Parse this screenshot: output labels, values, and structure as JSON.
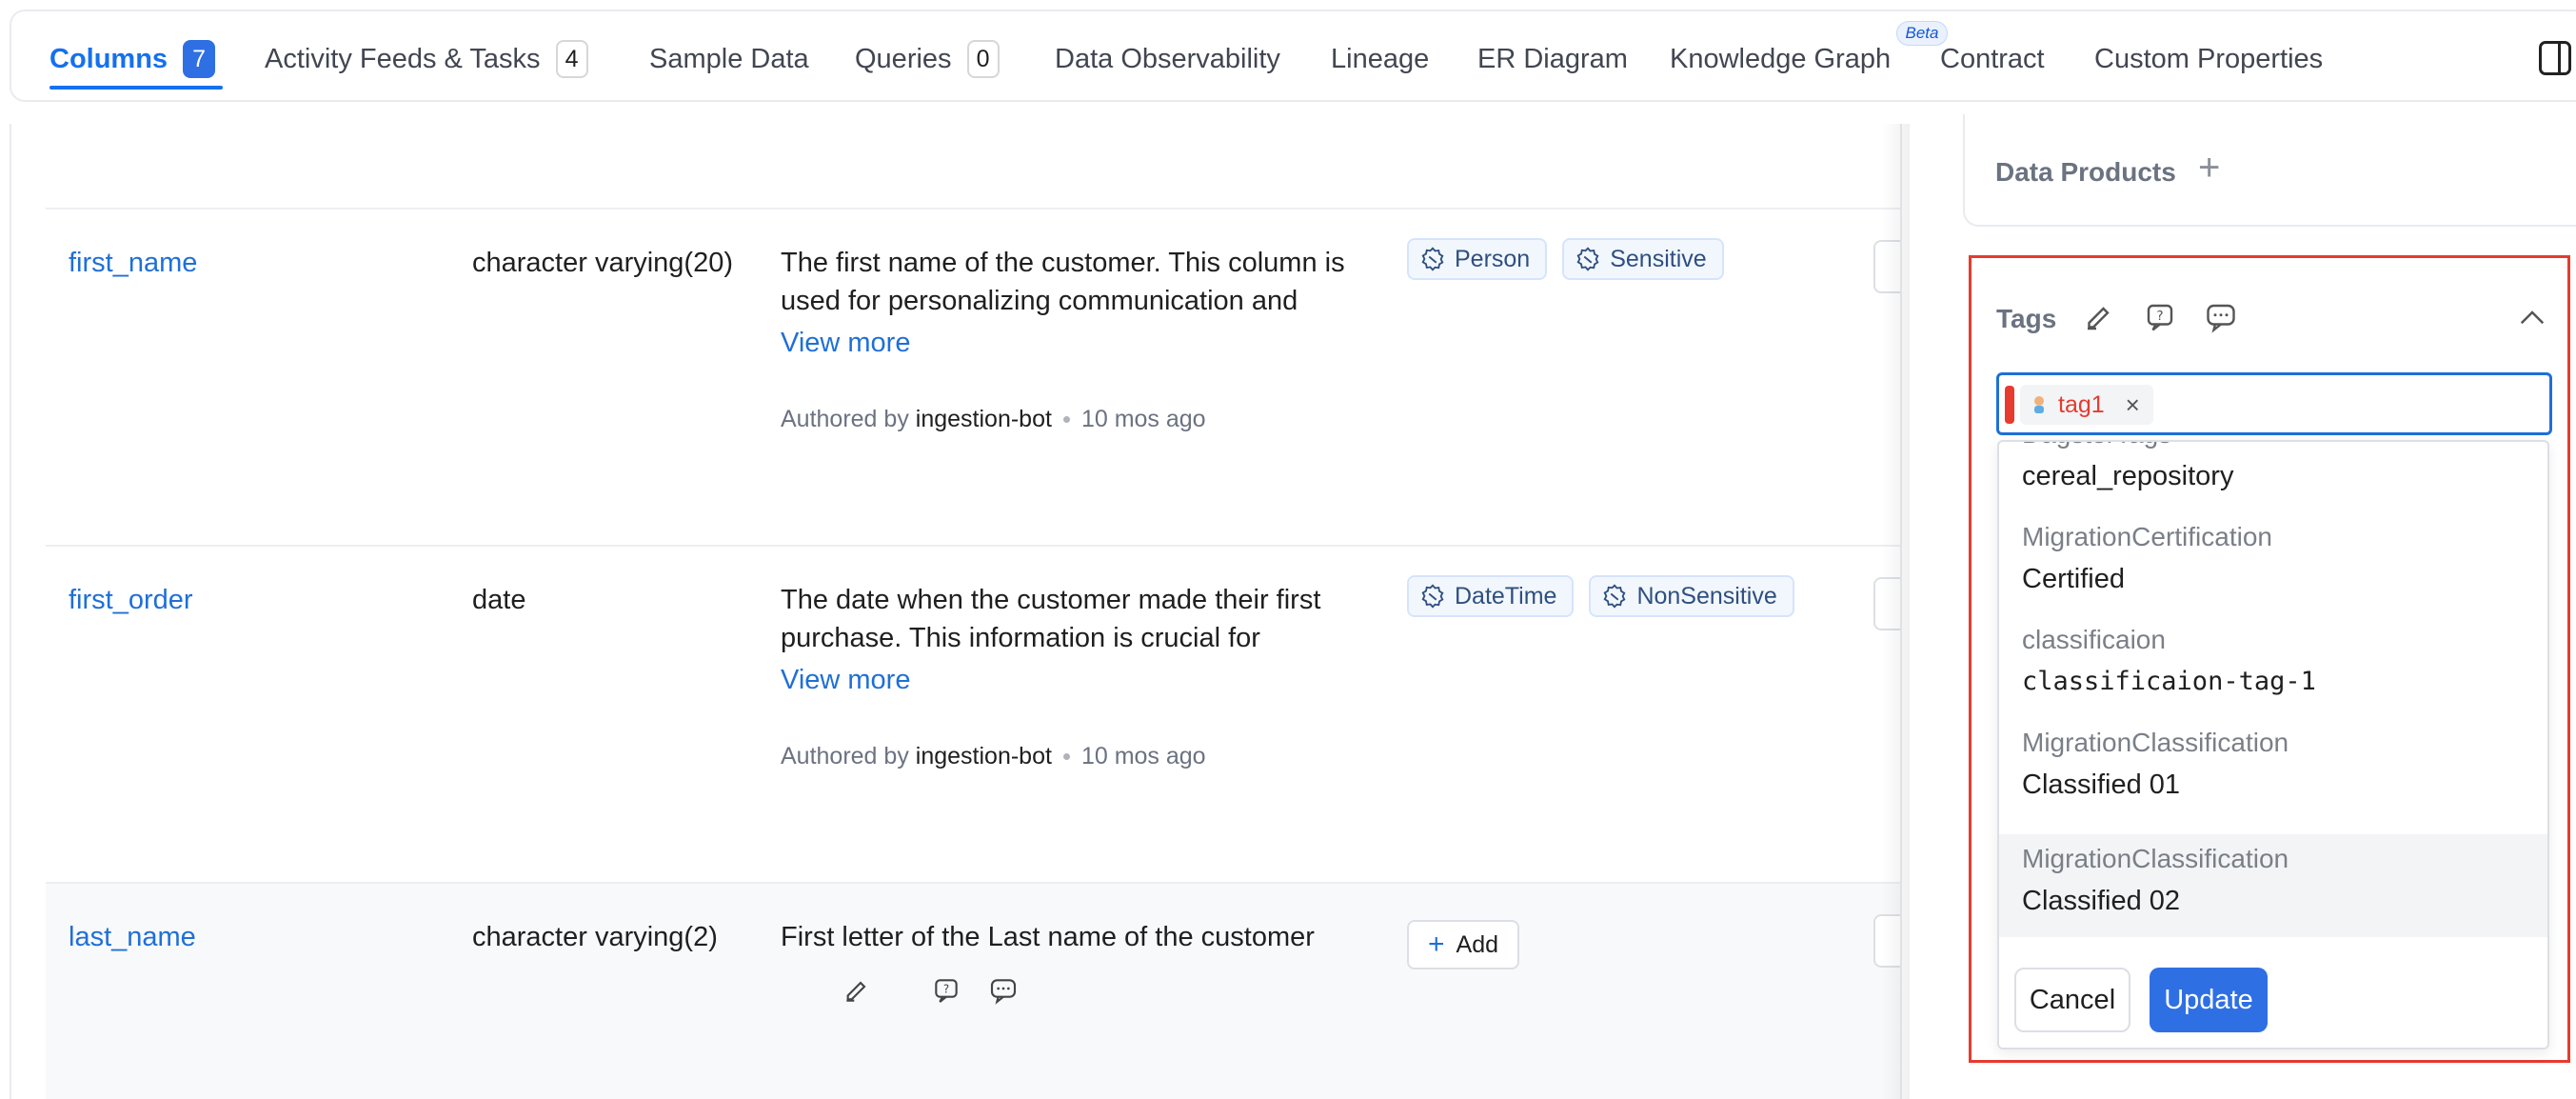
{
  "tabs": [
    {
      "label": "Columns",
      "count": "7"
    },
    {
      "label": "Activity Feeds & Tasks",
      "count": "4"
    },
    {
      "label": "Sample Data"
    },
    {
      "label": "Queries",
      "count": "0"
    },
    {
      "label": "Data Observability"
    },
    {
      "label": "Lineage"
    },
    {
      "label": "ER Diagram"
    },
    {
      "label": "Knowledge Graph",
      "badge": "Beta"
    },
    {
      "label": "Contract"
    },
    {
      "label": "Custom Properties"
    }
  ],
  "rows": [
    {
      "name": "first_name",
      "type": "character varying(20)",
      "description": "The first name of the customer. This column is used for personalizing communication and identifying customers.",
      "view_more": "View more",
      "authored_prefix": "Authored by",
      "author": "ingestion-bot",
      "time": "10 mos ago",
      "tags": [
        "Person",
        "Sensitive"
      ]
    },
    {
      "name": "first_order",
      "type": "date",
      "description": "The date when the customer made their first purchase. This information is crucial for analyzing customer acquisition and retention.",
      "view_more": "View more",
      "authored_prefix": "Authored by",
      "author": "ingestion-bot",
      "time": "10 mos ago",
      "tags": [
        "DateTime",
        "NonSensitive"
      ]
    },
    {
      "name": "last_name",
      "type": "character varying(2)",
      "description": "First letter of the Last name of the customer",
      "add_label": "Add"
    }
  ],
  "sidebar": {
    "data_products_label": "Data Products",
    "tags_label": "Tags",
    "selected_tag": "tag1",
    "options": [
      {
        "category": "DagsterTags",
        "name": "cereal_repository"
      },
      {
        "category": "MigrationCertification",
        "name": "Certified"
      },
      {
        "category": "classificaion",
        "name": "classificaion-tag-1"
      },
      {
        "category": "MigrationClassification",
        "name": "Classified 01"
      },
      {
        "category": "MigrationClassification",
        "name": "Classified 02"
      }
    ],
    "cancel_label": "Cancel",
    "update_label": "Update"
  },
  "colors": {
    "accent": "#1570ef",
    "highlight_border": "#e63b2e",
    "tag_chip_bg": "#f2f7fe"
  },
  "icons": [
    "gear-tag-icon",
    "edit-icon",
    "request-icon",
    "conversation-icon",
    "chevron-up-icon",
    "close-icon",
    "plus-icon",
    "panel-toggle-icon"
  ]
}
